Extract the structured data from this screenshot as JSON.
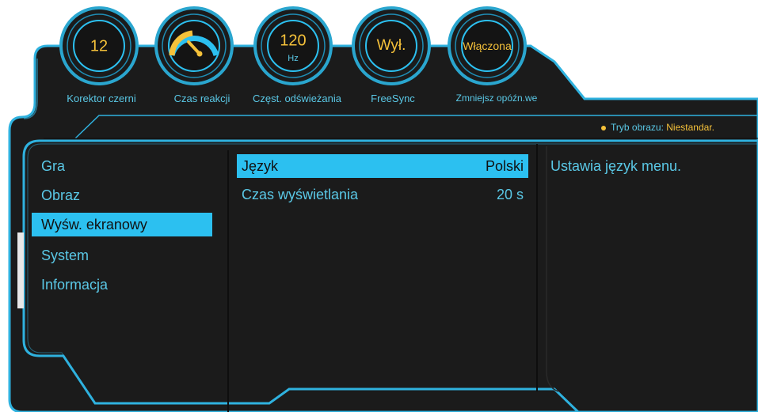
{
  "gauges": [
    {
      "value": "12",
      "unit": "",
      "label": "Korektor czerni",
      "icon": ""
    },
    {
      "value": "",
      "unit": "",
      "label": "Czas reakcji",
      "icon": "speedometer-icon"
    },
    {
      "value": "120",
      "unit": "Hz",
      "label": "Częst. odświeżania",
      "icon": ""
    },
    {
      "value": "Wył.",
      "unit": "",
      "label": "FreeSync",
      "icon": ""
    },
    {
      "value": "Włączona",
      "unit": "",
      "label": "Zmniejsz opóźn.we",
      "icon": ""
    }
  ],
  "status": {
    "label": "Tryb obrazu:",
    "value": "Niestandar."
  },
  "menu": {
    "items": [
      {
        "label": "Gra"
      },
      {
        "label": "Obraz"
      },
      {
        "label": "Wyśw. ekranowy"
      },
      {
        "label": "System"
      },
      {
        "label": "Informacja"
      }
    ],
    "selected_index": 2
  },
  "options": [
    {
      "label": "Język",
      "value": "Polski"
    },
    {
      "label": "Czas wyświetlania",
      "value": "20 s"
    }
  ],
  "description": "Ustawia język menu.",
  "colors": {
    "accent": "#2cc0f0",
    "value_yellow": "#f5c13a",
    "panel_bg": "#1b1b1b",
    "label_blue": "#5ac8e6"
  }
}
